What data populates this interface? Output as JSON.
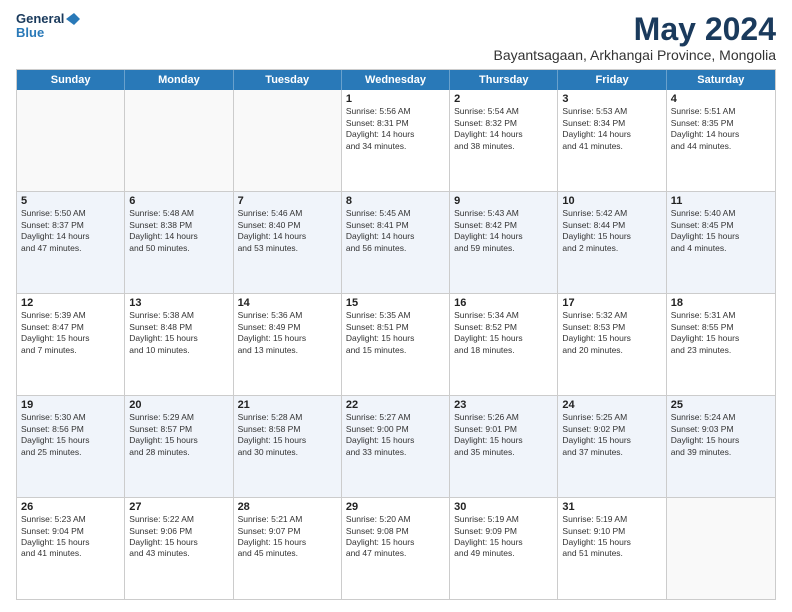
{
  "logo": {
    "line1": "General",
    "line2": "Blue"
  },
  "title": "May 2024",
  "subtitle": "Bayantsagaan, Arkhangai Province, Mongolia",
  "header_days": [
    "Sunday",
    "Monday",
    "Tuesday",
    "Wednesday",
    "Thursday",
    "Friday",
    "Saturday"
  ],
  "rows": [
    {
      "alt": false,
      "cells": [
        {
          "day": "",
          "info": ""
        },
        {
          "day": "",
          "info": ""
        },
        {
          "day": "",
          "info": ""
        },
        {
          "day": "1",
          "info": "Sunrise: 5:56 AM\nSunset: 8:31 PM\nDaylight: 14 hours\nand 34 minutes."
        },
        {
          "day": "2",
          "info": "Sunrise: 5:54 AM\nSunset: 8:32 PM\nDaylight: 14 hours\nand 38 minutes."
        },
        {
          "day": "3",
          "info": "Sunrise: 5:53 AM\nSunset: 8:34 PM\nDaylight: 14 hours\nand 41 minutes."
        },
        {
          "day": "4",
          "info": "Sunrise: 5:51 AM\nSunset: 8:35 PM\nDaylight: 14 hours\nand 44 minutes."
        }
      ]
    },
    {
      "alt": true,
      "cells": [
        {
          "day": "5",
          "info": "Sunrise: 5:50 AM\nSunset: 8:37 PM\nDaylight: 14 hours\nand 47 minutes."
        },
        {
          "day": "6",
          "info": "Sunrise: 5:48 AM\nSunset: 8:38 PM\nDaylight: 14 hours\nand 50 minutes."
        },
        {
          "day": "7",
          "info": "Sunrise: 5:46 AM\nSunset: 8:40 PM\nDaylight: 14 hours\nand 53 minutes."
        },
        {
          "day": "8",
          "info": "Sunrise: 5:45 AM\nSunset: 8:41 PM\nDaylight: 14 hours\nand 56 minutes."
        },
        {
          "day": "9",
          "info": "Sunrise: 5:43 AM\nSunset: 8:42 PM\nDaylight: 14 hours\nand 59 minutes."
        },
        {
          "day": "10",
          "info": "Sunrise: 5:42 AM\nSunset: 8:44 PM\nDaylight: 15 hours\nand 2 minutes."
        },
        {
          "day": "11",
          "info": "Sunrise: 5:40 AM\nSunset: 8:45 PM\nDaylight: 15 hours\nand 4 minutes."
        }
      ]
    },
    {
      "alt": false,
      "cells": [
        {
          "day": "12",
          "info": "Sunrise: 5:39 AM\nSunset: 8:47 PM\nDaylight: 15 hours\nand 7 minutes."
        },
        {
          "day": "13",
          "info": "Sunrise: 5:38 AM\nSunset: 8:48 PM\nDaylight: 15 hours\nand 10 minutes."
        },
        {
          "day": "14",
          "info": "Sunrise: 5:36 AM\nSunset: 8:49 PM\nDaylight: 15 hours\nand 13 minutes."
        },
        {
          "day": "15",
          "info": "Sunrise: 5:35 AM\nSunset: 8:51 PM\nDaylight: 15 hours\nand 15 minutes."
        },
        {
          "day": "16",
          "info": "Sunrise: 5:34 AM\nSunset: 8:52 PM\nDaylight: 15 hours\nand 18 minutes."
        },
        {
          "day": "17",
          "info": "Sunrise: 5:32 AM\nSunset: 8:53 PM\nDaylight: 15 hours\nand 20 minutes."
        },
        {
          "day": "18",
          "info": "Sunrise: 5:31 AM\nSunset: 8:55 PM\nDaylight: 15 hours\nand 23 minutes."
        }
      ]
    },
    {
      "alt": true,
      "cells": [
        {
          "day": "19",
          "info": "Sunrise: 5:30 AM\nSunset: 8:56 PM\nDaylight: 15 hours\nand 25 minutes."
        },
        {
          "day": "20",
          "info": "Sunrise: 5:29 AM\nSunset: 8:57 PM\nDaylight: 15 hours\nand 28 minutes."
        },
        {
          "day": "21",
          "info": "Sunrise: 5:28 AM\nSunset: 8:58 PM\nDaylight: 15 hours\nand 30 minutes."
        },
        {
          "day": "22",
          "info": "Sunrise: 5:27 AM\nSunset: 9:00 PM\nDaylight: 15 hours\nand 33 minutes."
        },
        {
          "day": "23",
          "info": "Sunrise: 5:26 AM\nSunset: 9:01 PM\nDaylight: 15 hours\nand 35 minutes."
        },
        {
          "day": "24",
          "info": "Sunrise: 5:25 AM\nSunset: 9:02 PM\nDaylight: 15 hours\nand 37 minutes."
        },
        {
          "day": "25",
          "info": "Sunrise: 5:24 AM\nSunset: 9:03 PM\nDaylight: 15 hours\nand 39 minutes."
        }
      ]
    },
    {
      "alt": false,
      "cells": [
        {
          "day": "26",
          "info": "Sunrise: 5:23 AM\nSunset: 9:04 PM\nDaylight: 15 hours\nand 41 minutes."
        },
        {
          "day": "27",
          "info": "Sunrise: 5:22 AM\nSunset: 9:06 PM\nDaylight: 15 hours\nand 43 minutes."
        },
        {
          "day": "28",
          "info": "Sunrise: 5:21 AM\nSunset: 9:07 PM\nDaylight: 15 hours\nand 45 minutes."
        },
        {
          "day": "29",
          "info": "Sunrise: 5:20 AM\nSunset: 9:08 PM\nDaylight: 15 hours\nand 47 minutes."
        },
        {
          "day": "30",
          "info": "Sunrise: 5:19 AM\nSunset: 9:09 PM\nDaylight: 15 hours\nand 49 minutes."
        },
        {
          "day": "31",
          "info": "Sunrise: 5:19 AM\nSunset: 9:10 PM\nDaylight: 15 hours\nand 51 minutes."
        },
        {
          "day": "",
          "info": ""
        }
      ]
    }
  ]
}
